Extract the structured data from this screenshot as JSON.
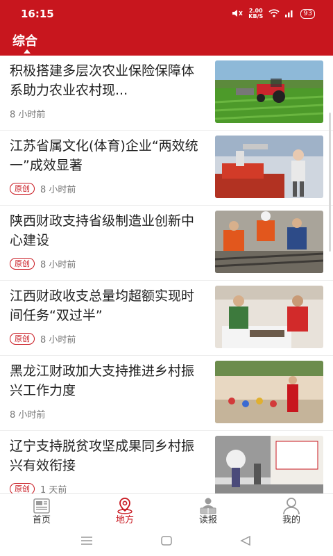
{
  "status_bar": {
    "time": "16:15",
    "speed_value": "2.00",
    "speed_unit": "KB/S",
    "battery": "93"
  },
  "tabs": {
    "active_label": "综合"
  },
  "news": [
    {
      "title": "积极搭建多层次农业保险保障体系助力农业农村现...",
      "time": "8 小时前",
      "badge": "",
      "image": "tractor-field-photo"
    },
    {
      "title": "江苏省属文化(体育)企业“两效统一”成效显著",
      "time": "8 小时前",
      "badge": "原创",
      "image": "robot-exhibition-photo"
    },
    {
      "title": "陕西财政支持省级制造业创新中心建设",
      "time": "8 小时前",
      "badge": "原创",
      "image": "railway-workers-photo"
    },
    {
      "title": "江西财政收支总量均超额实现时间任务“双过半”",
      "time": "8 小时前",
      "badge": "原创",
      "image": "food-vendors-photo"
    },
    {
      "title": "黑龙江财政加大支持推进乡村振兴工作力度",
      "time": "8 小时前",
      "badge": "",
      "image": "rural-performance-photo"
    },
    {
      "title": "辽宁支持脱贫攻坚成果同乡村振兴有效衔接",
      "time": "1 天前",
      "badge": "原创",
      "image": "village-street-photo"
    }
  ],
  "bottom_nav": {
    "items": [
      {
        "label": "首页",
        "icon": "newspaper-icon",
        "active": false
      },
      {
        "label": "地方",
        "icon": "location-pin-icon",
        "active": true
      },
      {
        "label": "读报",
        "icon": "reader-icon",
        "active": false
      },
      {
        "label": "我的",
        "icon": "user-icon",
        "active": false
      }
    ]
  },
  "colors": {
    "brand": "#c8161e",
    "text": "#222222",
    "meta": "#777777"
  }
}
